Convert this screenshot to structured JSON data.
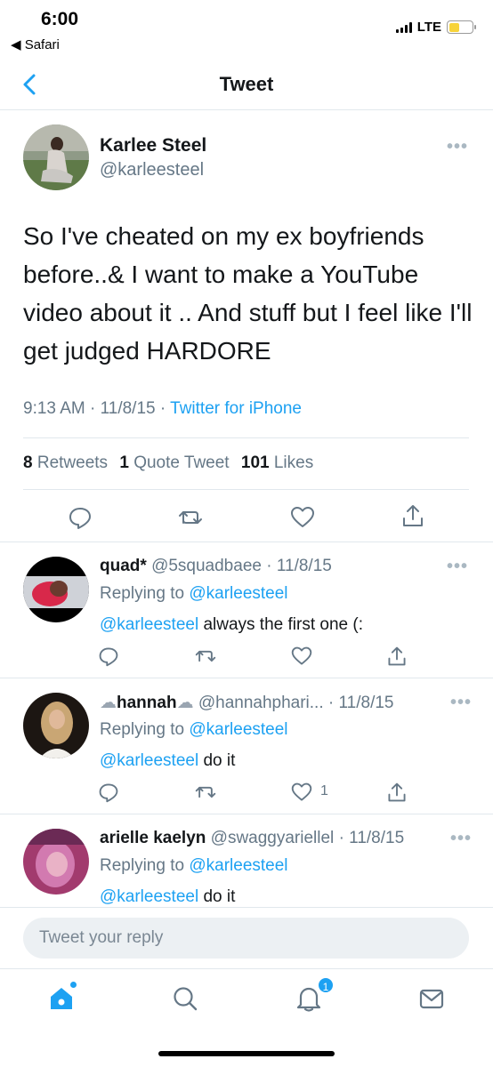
{
  "status_bar": {
    "time": "6:00",
    "back_app": "◀ Safari",
    "network": "LTE",
    "battery_level": 0.45,
    "battery_color": "#f7d33a"
  },
  "header": {
    "title": "Tweet",
    "back_icon": "chevron-left-icon"
  },
  "tweet": {
    "name": "Karlee Steel",
    "handle": "@karleesteel",
    "more": "•••",
    "text": "So I've cheated  on my ex boyfriends before..& I want to make a YouTube video about it .. And stuff but I feel like I'll get judged HARDORE",
    "time": "9:13 AM",
    "date": "11/8/15",
    "source": "Twitter for iPhone",
    "sep": "·",
    "retweets_count": "8",
    "retweets_label": "Retweets",
    "quotes_count": "1",
    "quotes_label": "Quote Tweet",
    "likes_count": "101",
    "likes_label": "Likes"
  },
  "replies": [
    {
      "name": "quad*",
      "handle": "@5squadbaee",
      "date": "· 11/8/15",
      "replying_label": "Replying to",
      "replying_to": "@karleesteel",
      "mention": "@karleesteel",
      "text": " always the first one (:",
      "like_count": ""
    },
    {
      "name_prefix": "☁",
      "name": "hannah",
      "name_suffix": "☁",
      "handle": "@hannahphari...",
      "date": "· 11/8/15",
      "replying_label": "Replying to",
      "replying_to": "@karleesteel",
      "mention": "@karleesteel",
      "text": " do it",
      "like_count": "1"
    },
    {
      "name": "arielle kaelyn",
      "handle": "@swaggyariellel",
      "date": "· 11/8/15",
      "replying_label": "Replying to",
      "replying_to": "@karleesteel",
      "mention": "@karleesteel",
      "text": " do it",
      "like_count": ""
    }
  ],
  "composer": {
    "placeholder": "Tweet your reply"
  },
  "tab_bar": {
    "tabs": [
      "home-icon",
      "search-icon",
      "notifications-icon",
      "messages-icon"
    ],
    "notification_badge": "1"
  },
  "colors": {
    "accent": "#1da1f2",
    "secondary_text": "#657786",
    "divider": "#e1e8ed"
  }
}
